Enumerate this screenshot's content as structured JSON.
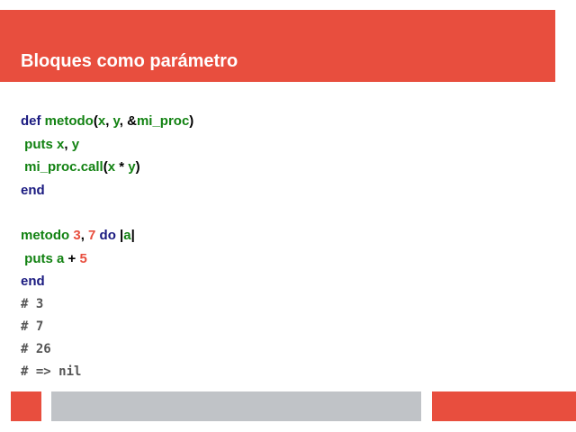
{
  "slide": {
    "title": "Bloques como parámetro"
  },
  "code": {
    "l1": {
      "def": "def",
      "name": "metodo",
      "p1": "(",
      "x": "x",
      "c1": ", ",
      "y": "y",
      "c2": ", &",
      "proc": "mi_proc",
      "p2": ")"
    },
    "l2": {
      "puts": "puts",
      "x": "x",
      "c": ", ",
      "y": "y"
    },
    "l3": {
      "call": "mi_proc.call",
      "p1": "(",
      "x": "x",
      "op": " * ",
      "y": "y",
      "p2": ")"
    },
    "l4": {
      "end": "end"
    },
    "l6": {
      "name": "metodo",
      "n1": "3",
      "c": ", ",
      "n2": "7",
      "do": "do",
      "b1": "|",
      "a": "a",
      "b2": "|"
    },
    "l7": {
      "puts": "puts",
      "a": "a",
      "op": " + ",
      "n": "5"
    },
    "l8": {
      "end": "end"
    },
    "comments": [
      "# 3",
      "# 7",
      "# 26",
      "# => nil"
    ]
  },
  "colors": {
    "accent": "#e84e3e",
    "keyword": "#1a1a80",
    "identifier": "#128212",
    "footer_gray": "#c0c3c7"
  }
}
